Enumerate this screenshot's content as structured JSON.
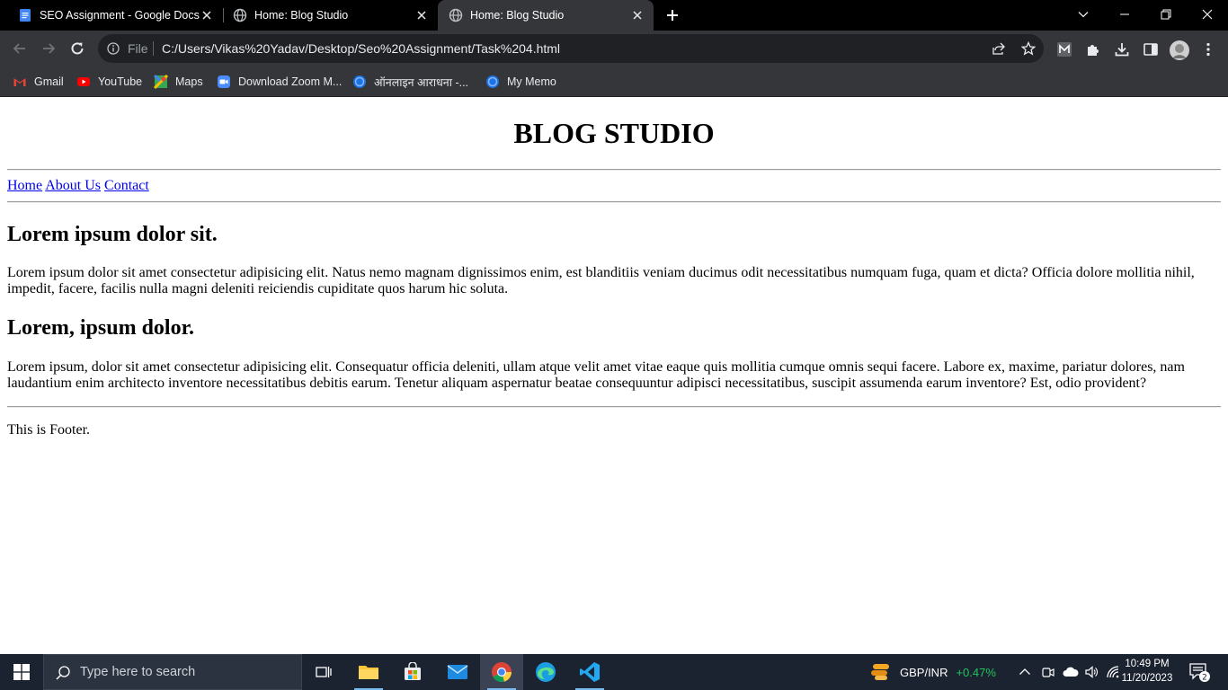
{
  "browser": {
    "tabs": [
      {
        "title": "SEO Assignment - Google Docs",
        "icon": "google-docs-icon"
      },
      {
        "title": "Home: Blog Studio",
        "icon": "globe-icon"
      },
      {
        "title": "Home: Blog Studio",
        "icon": "globe-icon",
        "active": true
      }
    ],
    "omnibox": {
      "scheme_label": "File",
      "url": "C:/Users/Vikas%20Yadav/Desktop/Seo%20Assignment/Task%204.html"
    },
    "bookmarks": [
      {
        "label": "Gmail",
        "icon": "gmail-icon"
      },
      {
        "label": "YouTube",
        "icon": "youtube-icon"
      },
      {
        "label": "Maps",
        "icon": "maps-icon"
      },
      {
        "label": "Download Zoom M...",
        "icon": "zoom-icon"
      },
      {
        "label": "ऑनलाइन आराधना -...",
        "icon": "site-icon"
      },
      {
        "label": "My Memo",
        "icon": "site-icon"
      }
    ]
  },
  "page": {
    "title": "BLOG STUDIO",
    "nav": [
      "Home",
      "About Us",
      "Contact"
    ],
    "sections": [
      {
        "heading": "Lorem ipsum dolor sit.",
        "body": "Lorem ipsum dolor sit amet consectetur adipisicing elit. Natus nemo magnam dignissimos enim, est blanditiis veniam ducimus odit necessitatibus numquam fuga, quam et dicta? Officia dolore mollitia nihil, impedit, facere, facilis nulla magni deleniti reiciendis cupiditate quos harum hic soluta."
      },
      {
        "heading": "Lorem, ipsum dolor.",
        "body": "Lorem ipsum, dolor sit amet consectetur adipisicing elit. Consequatur officia deleniti, ullam atque velit amet vitae eaque quis mollitia cumque omnis sequi facere. Labore ex, maxime, pariatur dolores, nam laudantium enim architecto inventore necessitatibus debitis earum. Tenetur aliquam aspernatur beatae consequuntur adipisci necessitatibus, suscipit assumenda earum inventore? Est, odio provident?"
      }
    ],
    "footer": "This is Footer."
  },
  "taskbar": {
    "search_placeholder": "Type here to search",
    "stock": {
      "name": "GBP/INR",
      "change": "+0.47%"
    },
    "time": "10:49 PM",
    "date": "11/20/2023",
    "notification_count": "2"
  },
  "colors": {
    "link": "#0000ee",
    "chrome_dark": "#35363a",
    "taskbar": "#1c2330",
    "stock_up": "#1ec45d"
  }
}
